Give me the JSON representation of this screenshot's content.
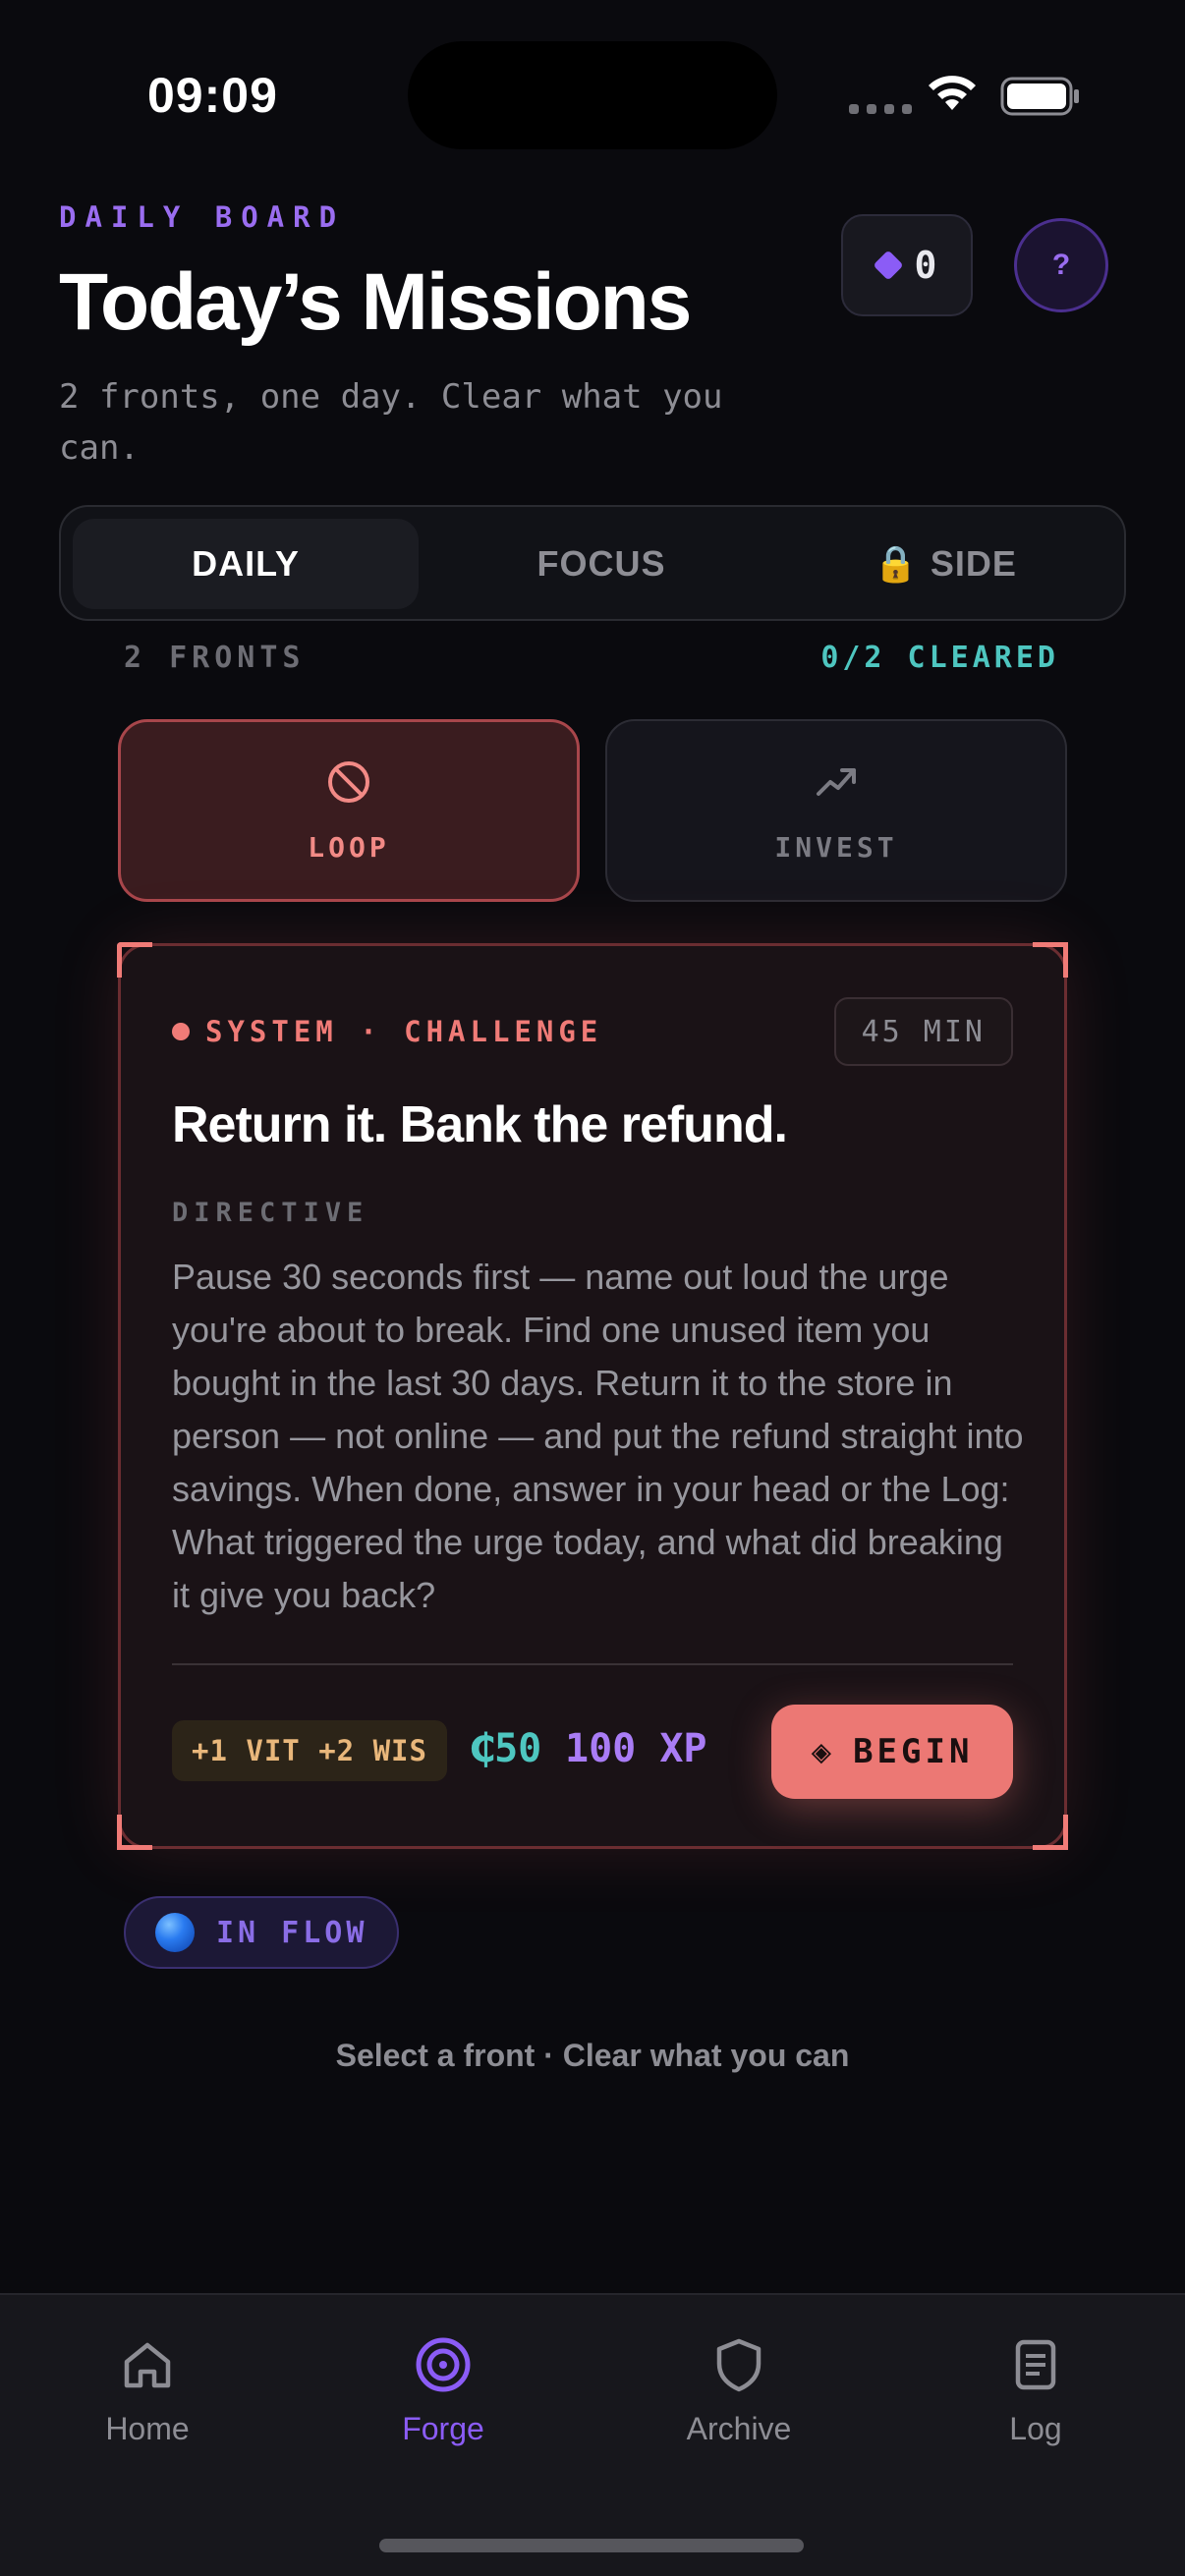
{
  "status_bar": {
    "time": "09:09"
  },
  "header": {
    "eyebrow": "DAILY BOARD",
    "title": "Today’s Missions",
    "subtitle": "2 fronts, one day. Clear what you can.",
    "gems": "0",
    "help_label": "?"
  },
  "tabs": [
    {
      "label": "DAILY",
      "active": true
    },
    {
      "label": "FOCUS",
      "active": false
    },
    {
      "label": "SIDE",
      "active": false,
      "locked": true
    }
  ],
  "fronts": {
    "count_label": "2 FRONTS",
    "cleared_label": "0/2 CLEARED",
    "items": [
      {
        "label": "LOOP",
        "icon": "prohibited-icon",
        "selected": true
      },
      {
        "label": "INVEST",
        "icon": "trending-up-icon",
        "selected": false
      }
    ]
  },
  "mission": {
    "tag": "SYSTEM · CHALLENGE",
    "duration": "45 MIN",
    "title": "Return it. Bank the refund.",
    "directive_label": "DIRECTIVE",
    "directive": "Pause 30 seconds first — name out loud the urge you're about to break. Find one unused item you bought in the last 30 days. Return it to the store in person — not online — and put the refund straight into savings. When done, answer in your head or the Log: What triggered the urge today, and what did breaking it give you back?",
    "stats": "+1 VIT +2 WIS",
    "coins": "₵50",
    "xp": "100 XP",
    "begin_label": "BEGIN",
    "begin_glyph": "◈"
  },
  "flow": {
    "label": "IN FLOW"
  },
  "hint": "Select a front · Clear what you can",
  "nav": [
    {
      "label": "Home",
      "icon": "home-icon",
      "active": false
    },
    {
      "label": "Forge",
      "icon": "target-icon",
      "active": true
    },
    {
      "label": "Archive",
      "icon": "shield-icon",
      "active": false
    },
    {
      "label": "Log",
      "icon": "document-icon",
      "active": false
    }
  ],
  "colors": {
    "accent_purple": "#8b5cf6",
    "accent_coral": "#ec7874",
    "accent_teal": "#4ec6c0",
    "background": "#0a0a0e"
  }
}
